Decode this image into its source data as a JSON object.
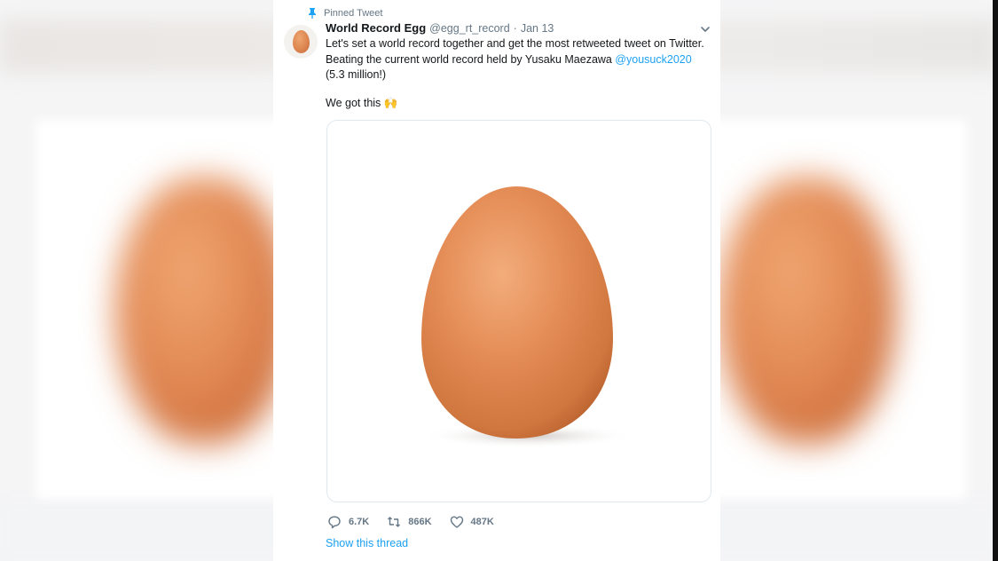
{
  "tweet": {
    "pinned_label": "Pinned Tweet",
    "author_name": "World Record Egg",
    "author_handle": "@egg_rt_record",
    "separator": "·",
    "date": "Jan 13",
    "text_part1": "Let's set a world record together and get the most retweeted tweet on Twitter. Beating the current world record held by Yusaku Maezawa ",
    "mention": "@yousuck2020",
    "text_part2": " (5.3 million!)",
    "text_line2": "We got this 🙌",
    "media_alt": "egg photo"
  },
  "actions": {
    "replies": "6.7K",
    "retweets": "866K",
    "likes": "487K"
  },
  "thread_link": "Show this thread",
  "icons": {
    "pin": "pin-icon",
    "caret": "chevron-down-icon",
    "reply": "reply-icon",
    "retweet": "retweet-icon",
    "like": "heart-icon"
  },
  "colors": {
    "accent": "#1da1f2",
    "secondary_text": "#657786",
    "primary_text": "#14171a",
    "egg": "#e08a55"
  }
}
